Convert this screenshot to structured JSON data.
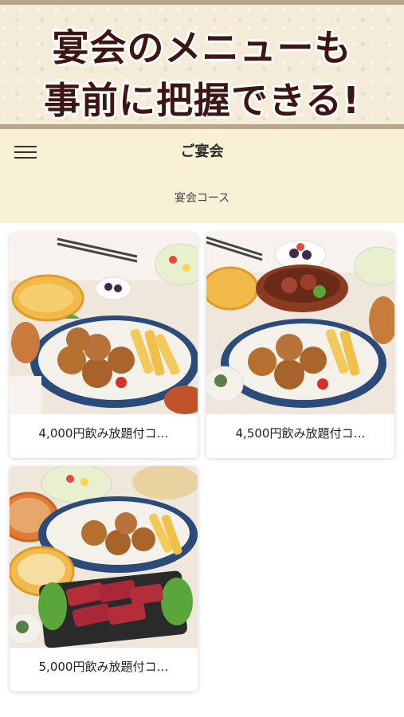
{
  "banner": {
    "line1": "宴会のメニューも",
    "line2": "事前に把握できる!"
  },
  "header": {
    "menu_icon": "hamburger-icon",
    "title": "ご宴会",
    "section": "宴会コース"
  },
  "courses": [
    {
      "title": "4,000円飲み放題付コ…",
      "image": "party-food-platter-karaage-fries"
    },
    {
      "title": "4,500円飲み放題付コ…",
      "image": "party-food-platter-stew-pot"
    },
    {
      "title": "5,000円飲み放題付コ…",
      "image": "party-food-platter-beef-tataki"
    }
  ],
  "colors": {
    "banner_bg": "#f4ebd9",
    "banner_text": "#3d1512",
    "header_bg": "#f8f1d6"
  }
}
